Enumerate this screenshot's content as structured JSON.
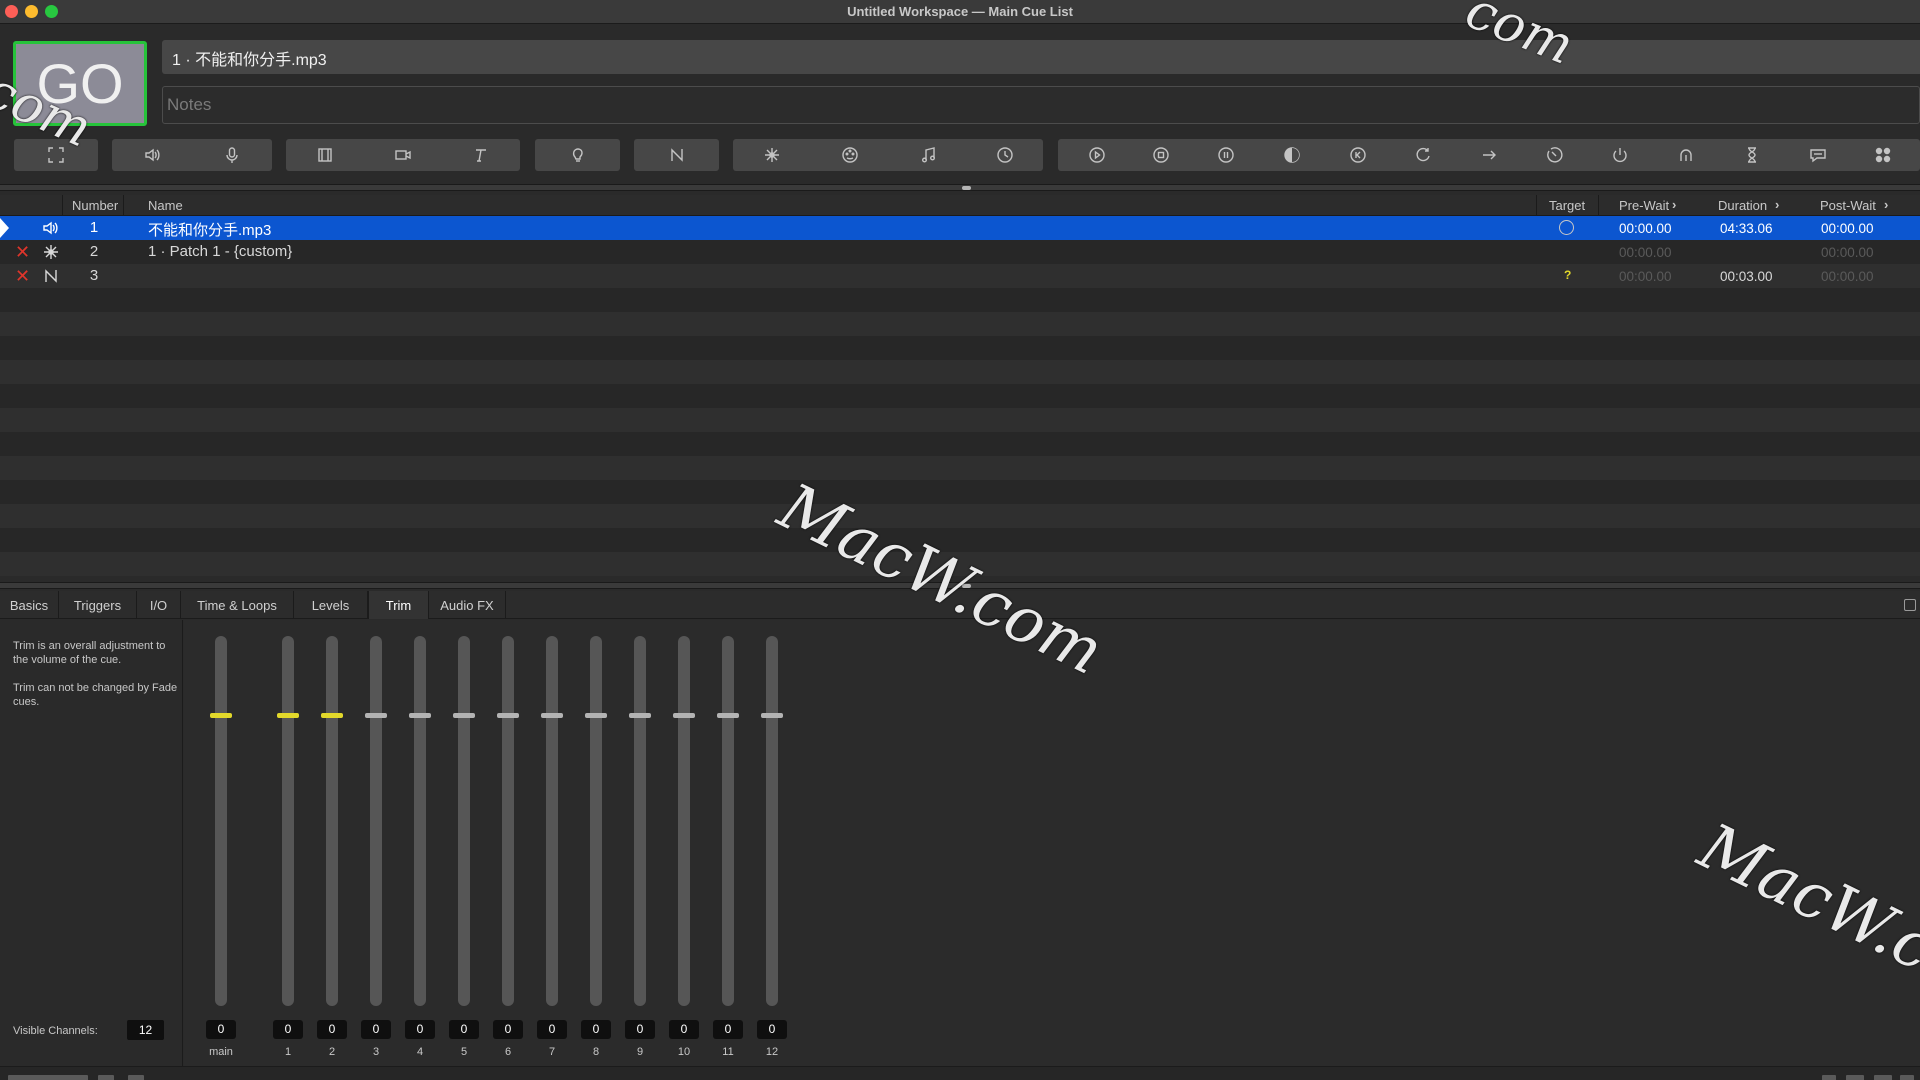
{
  "window": {
    "title": "Untitled Workspace — Main Cue List"
  },
  "go": {
    "label": "GO"
  },
  "current_cue": {
    "title": "1 · 不能和你分手.mp3",
    "notes_placeholder": "Notes"
  },
  "toolbar": {
    "icons": [
      "group-icon",
      "audio-icon",
      "mic-icon",
      "video-icon",
      "camera-icon",
      "text-icon",
      "light-icon",
      "fade-icon",
      "network-icon",
      "midi-icon",
      "music-icon",
      "timecode-icon",
      "start-icon",
      "stop-icon",
      "pause-icon",
      "load-icon",
      "reset-icon",
      "devamp-icon",
      "goto-icon",
      "target-icon",
      "arm-icon",
      "disarm-icon",
      "wait-icon",
      "memo-icon",
      "script-icon"
    ]
  },
  "cue_list": {
    "headers": {
      "number": "Number",
      "name": "Name",
      "target": "Target",
      "pre_wait": "Pre-Wait",
      "duration": "Duration",
      "post_wait": "Post-Wait"
    },
    "rows": [
      {
        "number": "1",
        "name": "不能和你分手.mp3",
        "type": "audio-icon",
        "broken": false,
        "target": "",
        "pre_wait": "00:00.00",
        "duration": "04:33.06",
        "post_wait": "00:00.00",
        "selected": true
      },
      {
        "number": "2",
        "name": "1 · Patch 1 - {custom}",
        "type": "network-icon",
        "broken": true,
        "target": "",
        "pre_wait": "00:00.00",
        "duration": "",
        "post_wait": "00:00.00",
        "selected": false
      },
      {
        "number": "3",
        "name": "",
        "type": "fade-icon",
        "broken": true,
        "target": "?",
        "pre_wait": "00:00.00",
        "duration": "00:03.00",
        "post_wait": "00:00.00",
        "selected": false
      }
    ]
  },
  "inspector": {
    "tabs": [
      "Basics",
      "Triggers",
      "I/O",
      "Time & Loops",
      "Levels",
      "Trim",
      "Audio FX"
    ],
    "active_tab": "Trim",
    "trim": {
      "help_1": "Trim is an overall adjustment to the volume of the cue.",
      "help_2": "Trim can not be changed by Fade cues.",
      "visible_channels_label": "Visible Channels:",
      "visible_channels": "12",
      "channels": [
        {
          "label": "main",
          "value": "0",
          "active": true
        },
        {
          "label": "1",
          "value": "0",
          "active": true
        },
        {
          "label": "2",
          "value": "0",
          "active": true
        },
        {
          "label": "3",
          "value": "0",
          "active": false
        },
        {
          "label": "4",
          "value": "0",
          "active": false
        },
        {
          "label": "5",
          "value": "0",
          "active": false
        },
        {
          "label": "6",
          "value": "0",
          "active": false
        },
        {
          "label": "7",
          "value": "0",
          "active": false
        },
        {
          "label": "8",
          "value": "0",
          "active": false
        },
        {
          "label": "9",
          "value": "0",
          "active": false
        },
        {
          "label": "10",
          "value": "0",
          "active": false
        },
        {
          "label": "11",
          "value": "0",
          "active": false
        },
        {
          "label": "12",
          "value": "0",
          "active": false
        }
      ]
    }
  },
  "watermark": {
    "text_main": "MacW.com",
    "text_top": "com",
    "text_go": "com",
    "text_right": "MacW.c"
  },
  "colors": {
    "go_border": "#26c33a",
    "selection": "#0c56d0",
    "fader_active": "#e2d82b",
    "broken_x": "#e0352b"
  }
}
